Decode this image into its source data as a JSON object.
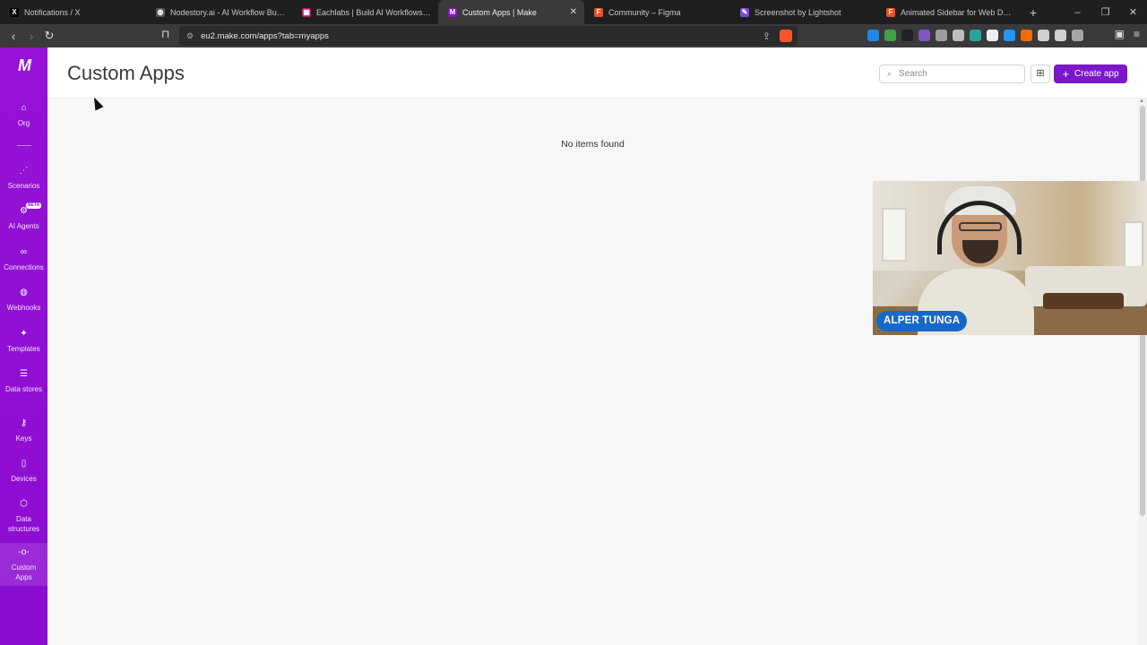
{
  "browser": {
    "tabs": [
      {
        "title": "Notifications / X",
        "favicon": "x-logo-icon",
        "color": "#000000",
        "glyph": "X"
      },
      {
        "title": "Nodestory.ai - AI Workflow Builder",
        "favicon": "globe-icon",
        "color": "#555555",
        "glyph": "◍"
      },
      {
        "title": "Eachlabs | Build AI Workflows in seco",
        "favicon": "eachlabs-icon",
        "color": "#c2185b",
        "glyph": "▦"
      },
      {
        "title": "Custom Apps | Make",
        "favicon": "make-icon",
        "color": "#8b0fd2",
        "glyph": "M",
        "active": true
      },
      {
        "title": "Community – Figma",
        "favicon": "figma-icon",
        "color": "#f24e1e",
        "glyph": "F"
      },
      {
        "title": "Screenshot by Lightshot",
        "favicon": "lightshot-icon",
        "color": "#7b4bd6",
        "glyph": "✎"
      },
      {
        "title": "Animated Sidebar for Web Dashboa",
        "favicon": "figma-icon",
        "color": "#f24e1e",
        "glyph": "F"
      }
    ],
    "new_tab": "+",
    "window_controls": {
      "minimize": "–",
      "restore": "❐",
      "close": "✕"
    },
    "url": "eu2.make.com/apps?tab=myapps"
  },
  "sidebar": {
    "logo": "M",
    "items": [
      {
        "label": "Org",
        "icon": "home-icon",
        "glyph": "⌂"
      },
      {
        "label": "Scenarios",
        "icon": "share-nodes-icon",
        "glyph": "⋰"
      },
      {
        "label": "AI Agents",
        "icon": "ai-agent-icon",
        "glyph": "⚙",
        "badge": "BETA"
      },
      {
        "label": "Connections",
        "icon": "link-icon",
        "glyph": "∞"
      },
      {
        "label": "Webhooks",
        "icon": "globe-icon",
        "glyph": "◍"
      },
      {
        "label": "Templates",
        "icon": "puzzle-icon",
        "glyph": "✦"
      },
      {
        "label": "Data stores",
        "icon": "database-icon",
        "glyph": "☰"
      },
      {
        "label": "Keys",
        "icon": "key-icon",
        "glyph": "⚷"
      },
      {
        "label": "Devices",
        "icon": "mobile-icon",
        "glyph": "▯"
      },
      {
        "label": "Data structures",
        "icon": "cube-icon",
        "glyph": "⬡"
      },
      {
        "label": "Custom Apps",
        "icon": "custom-apps-icon",
        "glyph": "-o-",
        "active": true
      }
    ]
  },
  "header": {
    "title": "Custom Apps",
    "search_placeholder": "Search",
    "create_label": "Create app"
  },
  "main": {
    "empty_message": "No items found"
  },
  "webcam": {
    "name": "ALPER TUNGA"
  },
  "colors": {
    "brand": "#8b0fd2",
    "button": "#7c17c9",
    "name_tag": "#1769c9"
  }
}
